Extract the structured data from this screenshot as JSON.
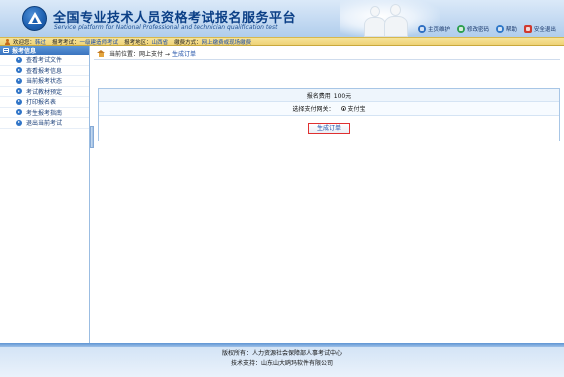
{
  "header": {
    "title_cn": "全国专业技术人员资格考试报名服务平台",
    "title_en": "Service platform for National Professional and technician qualification test",
    "links": [
      {
        "label": "主页维护",
        "icon": "home-icon"
      },
      {
        "label": "修改密码",
        "icon": "key-icon"
      },
      {
        "label": "帮助",
        "icon": "help-icon"
      },
      {
        "label": "安全退出",
        "icon": "exit-icon"
      }
    ]
  },
  "infobar": {
    "welcome_label": "欢迎您：",
    "user_name": "韩过",
    "exam_label": "报考考试：",
    "exam_value": "一级建造师考试",
    "region_label": "报考地区：",
    "region_value": "山西省",
    "pay_label": "缴费方式：",
    "pay_value": "网上缴费或现场缴费"
  },
  "sidebar": {
    "header": "报考信息",
    "items": [
      {
        "label": "查看考试文件"
      },
      {
        "label": "查看报考信息"
      },
      {
        "label": "当前报考状态"
      },
      {
        "label": "考试教材预定"
      },
      {
        "label": "打印报名表"
      },
      {
        "label": "考生报考指南"
      },
      {
        "label": "退出当前考试"
      }
    ]
  },
  "breadcrumb": {
    "label": "当前位置：网上支付 →",
    "current": "生成订单"
  },
  "payment": {
    "fee_label": "报名费用",
    "fee_value": "100元",
    "gateway_label": "选择支付网关：",
    "gateway_option": "支付宝",
    "submit_label": "生成订单"
  },
  "footer": {
    "copyright": "版权所有：人力资源社会保障部人事考试中心",
    "support": "技术支持：山东山大鸥玛软件有限公司"
  }
}
